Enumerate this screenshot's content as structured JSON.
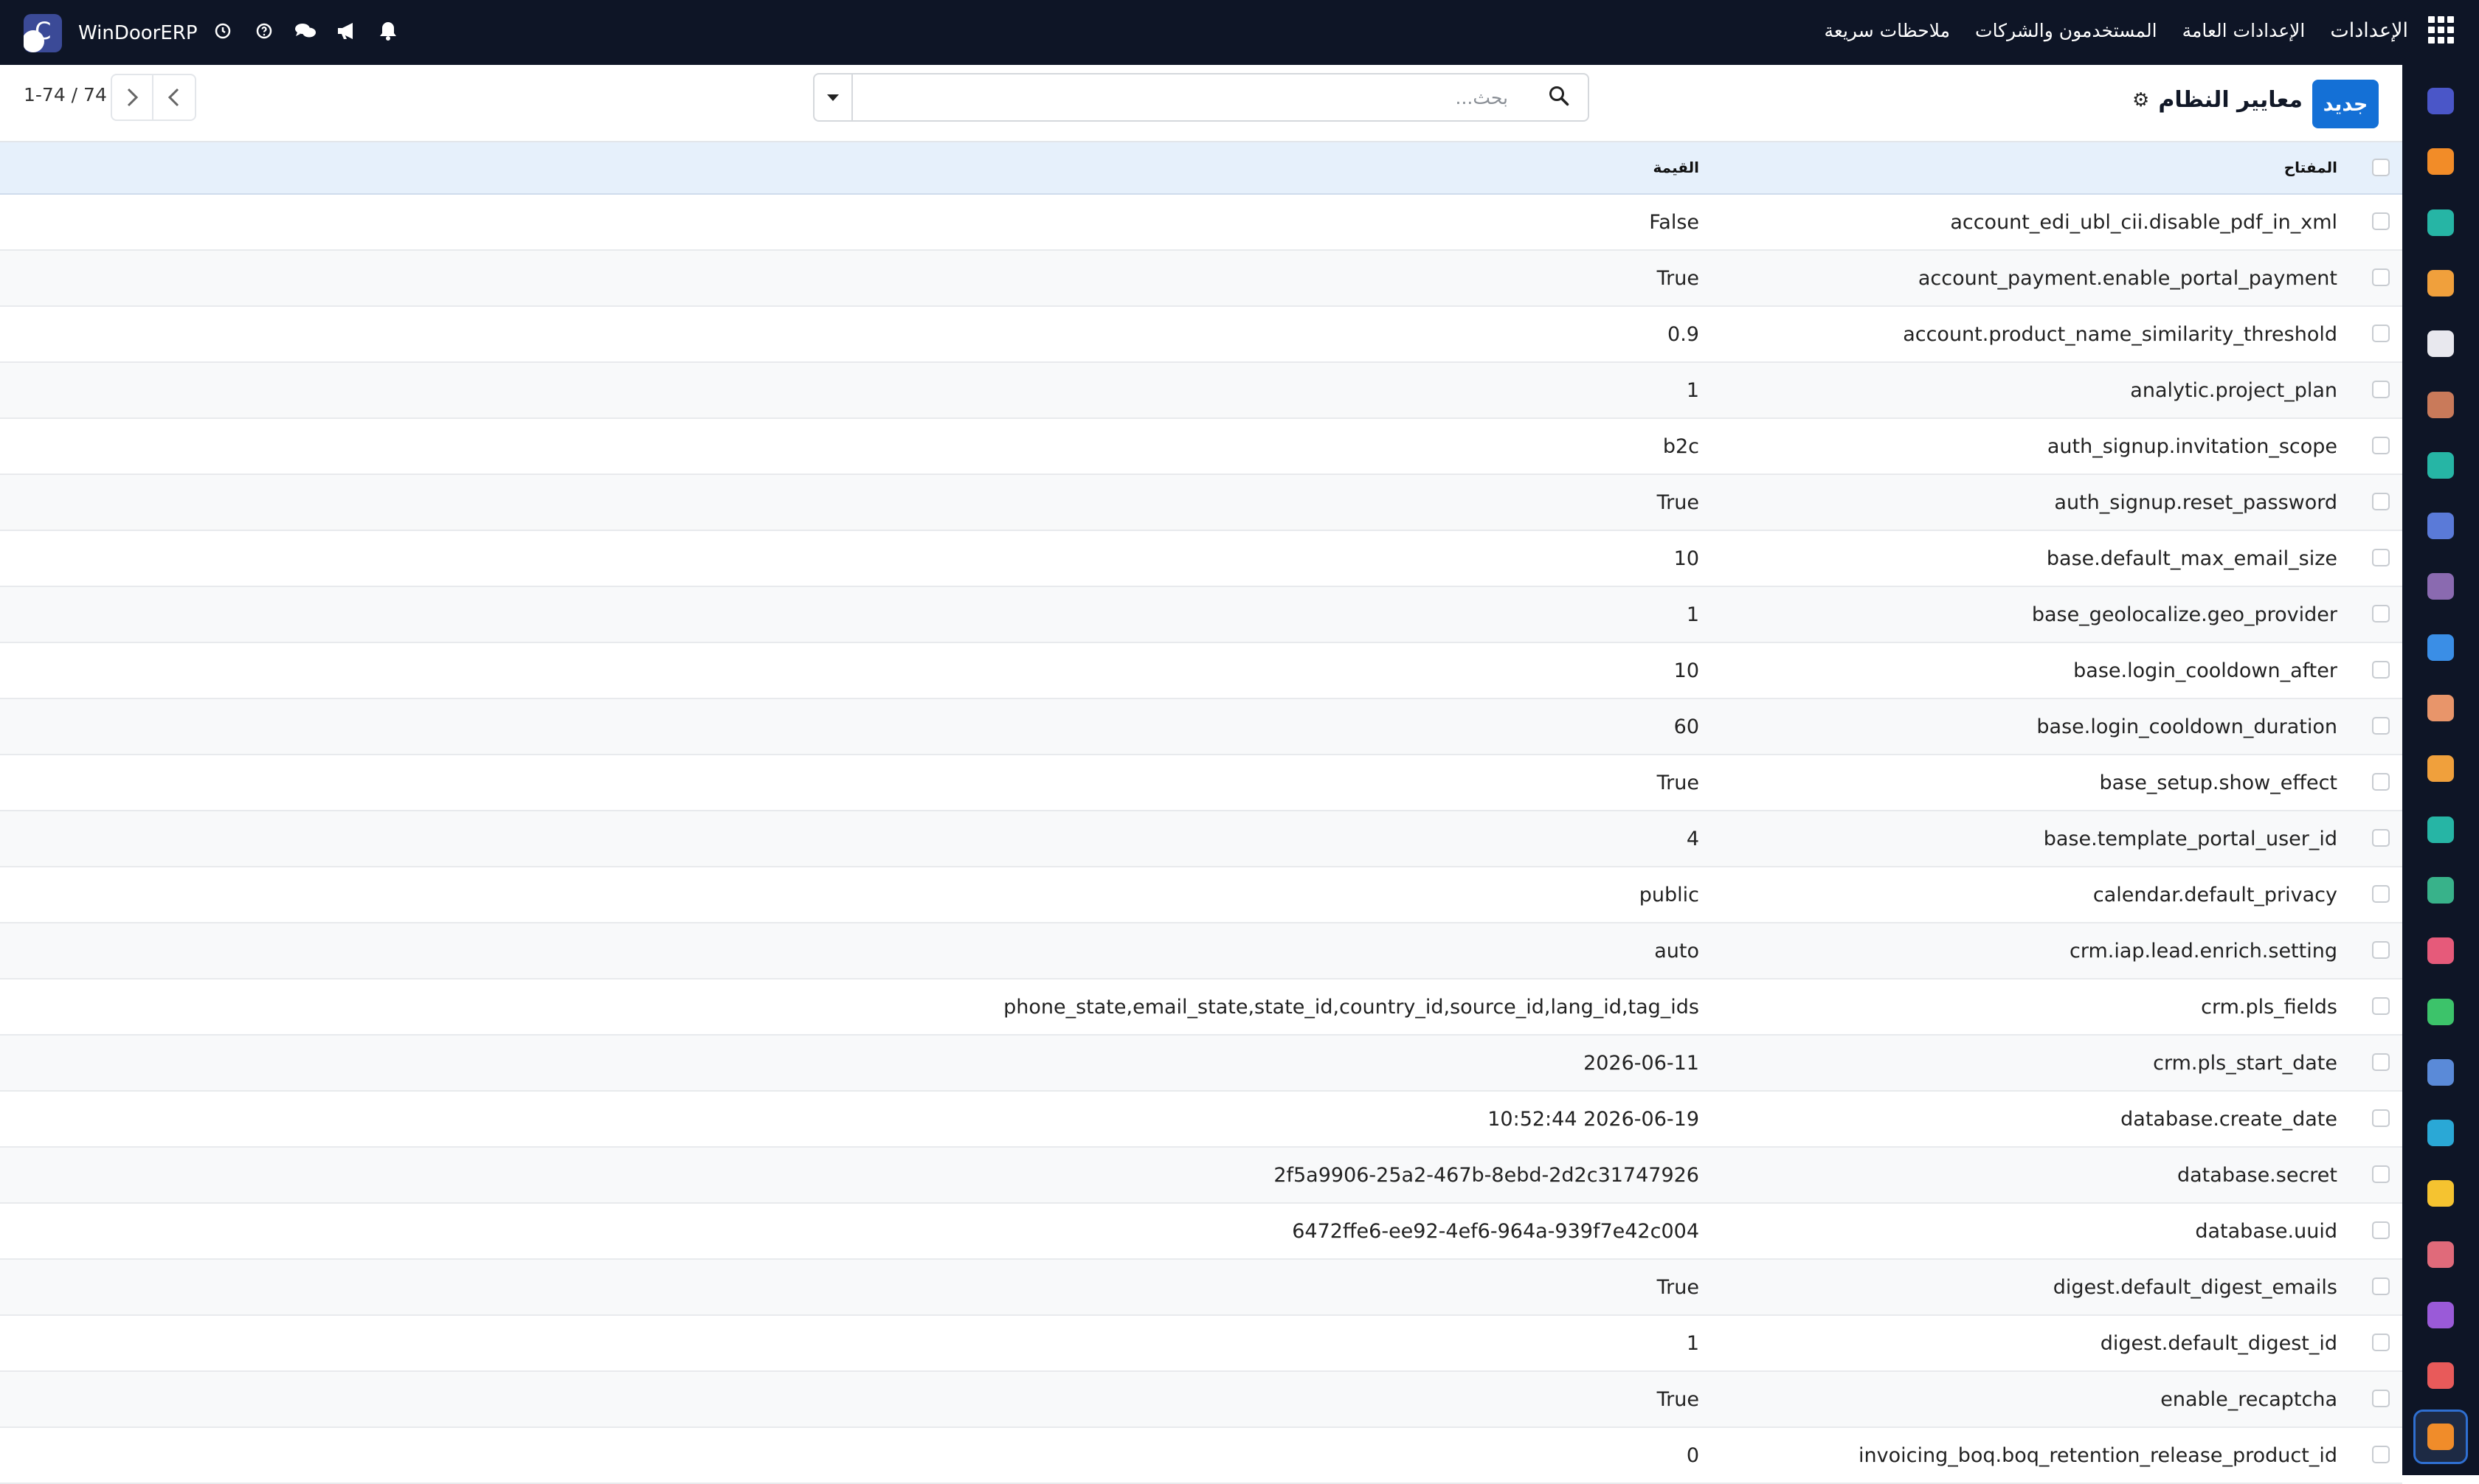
{
  "navbar": {
    "brand": "WinDoorERP",
    "menu": [
      "الإعدادات",
      "الإعدادات العامة",
      "المستخدمون والشركات",
      "ملاحظات سريعة"
    ],
    "system_icons": [
      "clock-icon",
      "help-icon",
      "chat-icon",
      "megaphone-icon",
      "bell-icon"
    ]
  },
  "control_panel": {
    "new_button": "جديد",
    "title": "معايير النظام",
    "search_placeholder": "بحث...",
    "pager": "1-74 / 74"
  },
  "table": {
    "columns": {
      "key": "المفتاح",
      "value": "القيمة"
    },
    "rows": [
      {
        "key": "account_edi_ubl_cii.disable_pdf_in_xml",
        "value": "False"
      },
      {
        "key": "account_payment.enable_portal_payment",
        "value": "True"
      },
      {
        "key": "account.product_name_similarity_threshold",
        "value": "0.9"
      },
      {
        "key": "analytic.project_plan",
        "value": "1"
      },
      {
        "key": "auth_signup.invitation_scope",
        "value": "b2c"
      },
      {
        "key": "auth_signup.reset_password",
        "value": "True"
      },
      {
        "key": "base.default_max_email_size",
        "value": "10"
      },
      {
        "key": "base_geolocalize.geo_provider",
        "value": "1"
      },
      {
        "key": "base.login_cooldown_after",
        "value": "10"
      },
      {
        "key": "base.login_cooldown_duration",
        "value": "60"
      },
      {
        "key": "base_setup.show_effect",
        "value": "True"
      },
      {
        "key": "base.template_portal_user_id",
        "value": "4"
      },
      {
        "key": "calendar.default_privacy",
        "value": "public"
      },
      {
        "key": "crm.iap.lead.enrich.setting",
        "value": "auto"
      },
      {
        "key": "crm.pls_fields",
        "value": "phone_state,email_state,state_id,country_id,source_id,lang_id,tag_ids"
      },
      {
        "key": "crm.pls_start_date",
        "value": "2026-06-11"
      },
      {
        "key": "database.create_date",
        "value": "10:52:44 2026-06-19"
      },
      {
        "key": "database.secret",
        "value": "2f5a9906-25a2-467b-8ebd-2d2c31747926"
      },
      {
        "key": "database.uuid",
        "value": "6472ffe6-ee92-4ef6-964a-939f7e42c004"
      },
      {
        "key": "digest.default_digest_emails",
        "value": "True"
      },
      {
        "key": "digest.default_digest_id",
        "value": "1"
      },
      {
        "key": "enable_recaptcha",
        "value": "True"
      },
      {
        "key": "invoicing_boq.boq_retention_release_product_id",
        "value": "0"
      }
    ]
  },
  "rail_apps": [
    {
      "icon": "email-marketing-icon",
      "color": "#4a56c8"
    },
    {
      "icon": "discuss-icon",
      "color": "#f28c28"
    },
    {
      "icon": "accounting-icon",
      "color": "#26b5a5"
    },
    {
      "icon": "reports-icon",
      "color": "#f0a03c"
    },
    {
      "icon": "inventory-icon",
      "color": "#e8e8ee"
    },
    {
      "icon": "contacts-card-icon",
      "color": "#c97a5a"
    },
    {
      "icon": "tasks-check-icon",
      "color": "#26b5a5"
    },
    {
      "icon": "knowledge-icon",
      "color": "#5a7ad8"
    },
    {
      "icon": "package-icon",
      "color": "#8a6ab0"
    },
    {
      "icon": "sales-icon",
      "color": "#3a8ee6"
    },
    {
      "icon": "employees-icon",
      "color": "#e8956a"
    },
    {
      "icon": "calendar-icon",
      "color": "#f0a03c"
    },
    {
      "icon": "sign-icon",
      "color": "#26b5a5"
    },
    {
      "icon": "contacts-icon",
      "color": "#38b28a"
    },
    {
      "icon": "dashboard-icon",
      "color": "#e65a7a"
    },
    {
      "icon": "whatsapp-icon",
      "color": "#3cc36a"
    },
    {
      "icon": "clock-app-icon",
      "color": "#5a8ad8"
    },
    {
      "icon": "website-icon",
      "color": "#2aa8d6"
    },
    {
      "icon": "telegram-icon",
      "color": "#f5c330"
    },
    {
      "icon": "layers-icon",
      "color": "#e06a7a"
    },
    {
      "icon": "module-icon",
      "color": "#9a5ad8"
    },
    {
      "icon": "pie-icon",
      "color": "#e85a5a"
    },
    {
      "icon": "settings-app-icon",
      "color": "#f08c2a"
    }
  ]
}
